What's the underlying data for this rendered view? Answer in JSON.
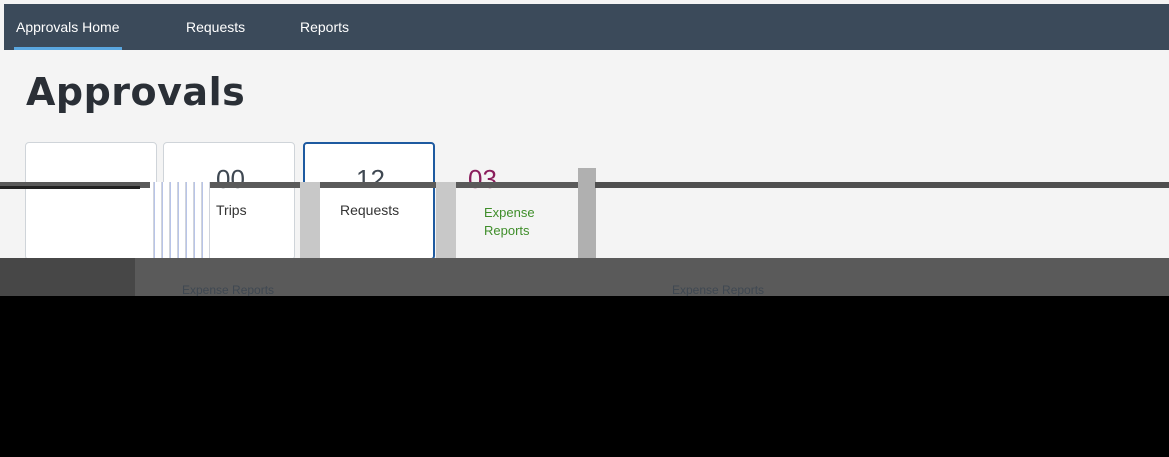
{
  "nav": {
    "items": [
      {
        "label": "Approvals Home",
        "active": true
      },
      {
        "label": "Requests",
        "active": false
      },
      {
        "label": "Reports",
        "active": false
      }
    ]
  },
  "page": {
    "title": "Approvals"
  },
  "tiles": [
    {
      "count": "00",
      "label": "Trips",
      "selected": false
    },
    {
      "count": "12",
      "label": "Requests",
      "selected": false
    },
    {
      "count": "03",
      "label": "Expense Reports",
      "selected": true
    }
  ],
  "sections": {
    "left_header": "Expense Reports",
    "right_header": "Expense Reports"
  },
  "colors": {
    "nav_background": "#3b4a5a",
    "nav_active_underline": "#5aa7e0",
    "selected_tile_border": "#1e5aa0",
    "count_accent": "#8a1e5c",
    "label_accent": "#3f8e2a"
  }
}
